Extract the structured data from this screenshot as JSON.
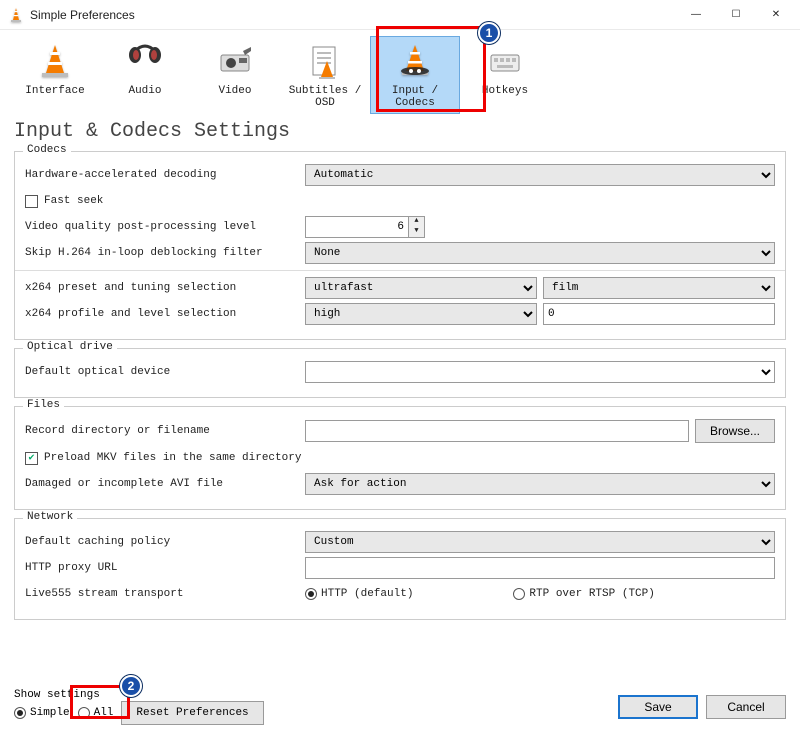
{
  "window": {
    "title": "Simple Preferences"
  },
  "toolbar": {
    "items": [
      {
        "label": "Interface"
      },
      {
        "label": "Audio"
      },
      {
        "label": "Video"
      },
      {
        "label": "Subtitles / OSD"
      },
      {
        "label": "Input / Codecs"
      },
      {
        "label": "Hotkeys"
      }
    ],
    "selected_index": 4
  },
  "page_title": "Input & Codecs Settings",
  "annotations": {
    "badge1": "1",
    "badge2": "2"
  },
  "codecs": {
    "legend": "Codecs",
    "hw_decoding_label": "Hardware-accelerated decoding",
    "hw_decoding_value": "Automatic",
    "fast_seek_label": "Fast seek",
    "fast_seek_checked": false,
    "vq_postproc_label": "Video quality post-processing level",
    "vq_postproc_value": "6",
    "skip_deblock_label": "Skip H.264 in-loop deblocking filter",
    "skip_deblock_value": "None",
    "x264_preset_label": "x264 preset and tuning selection",
    "x264_preset_value": "ultrafast",
    "x264_tuning_value": "film",
    "x264_profile_label": "x264 profile and level selection",
    "x264_profile_value": "high",
    "x264_level_value": "0"
  },
  "optical": {
    "legend": "Optical drive",
    "default_device_label": "Default optical device",
    "default_device_value": ""
  },
  "files": {
    "legend": "Files",
    "record_dir_label": "Record directory or filename",
    "record_dir_value": "",
    "browse_label": "Browse...",
    "preload_mkv_label": "Preload MKV files in the same directory",
    "preload_mkv_checked": true,
    "damaged_avi_label": "Damaged or incomplete AVI file",
    "damaged_avi_value": "Ask for action"
  },
  "network": {
    "legend": "Network",
    "caching_label": "Default caching policy",
    "caching_value": "Custom",
    "http_proxy_label": "HTTP proxy URL",
    "http_proxy_value": "",
    "stream_transport_label": "Live555 stream transport",
    "http_default_label": "HTTP (default)",
    "rtp_label": "RTP over RTSP (TCP)",
    "stream_transport_selected": "http"
  },
  "footer": {
    "show_settings_label": "Show settings",
    "simple_label": "Simple",
    "all_label": "All",
    "selected": "simple",
    "reset_label": "Reset Preferences",
    "save_label": "Save",
    "cancel_label": "Cancel"
  }
}
